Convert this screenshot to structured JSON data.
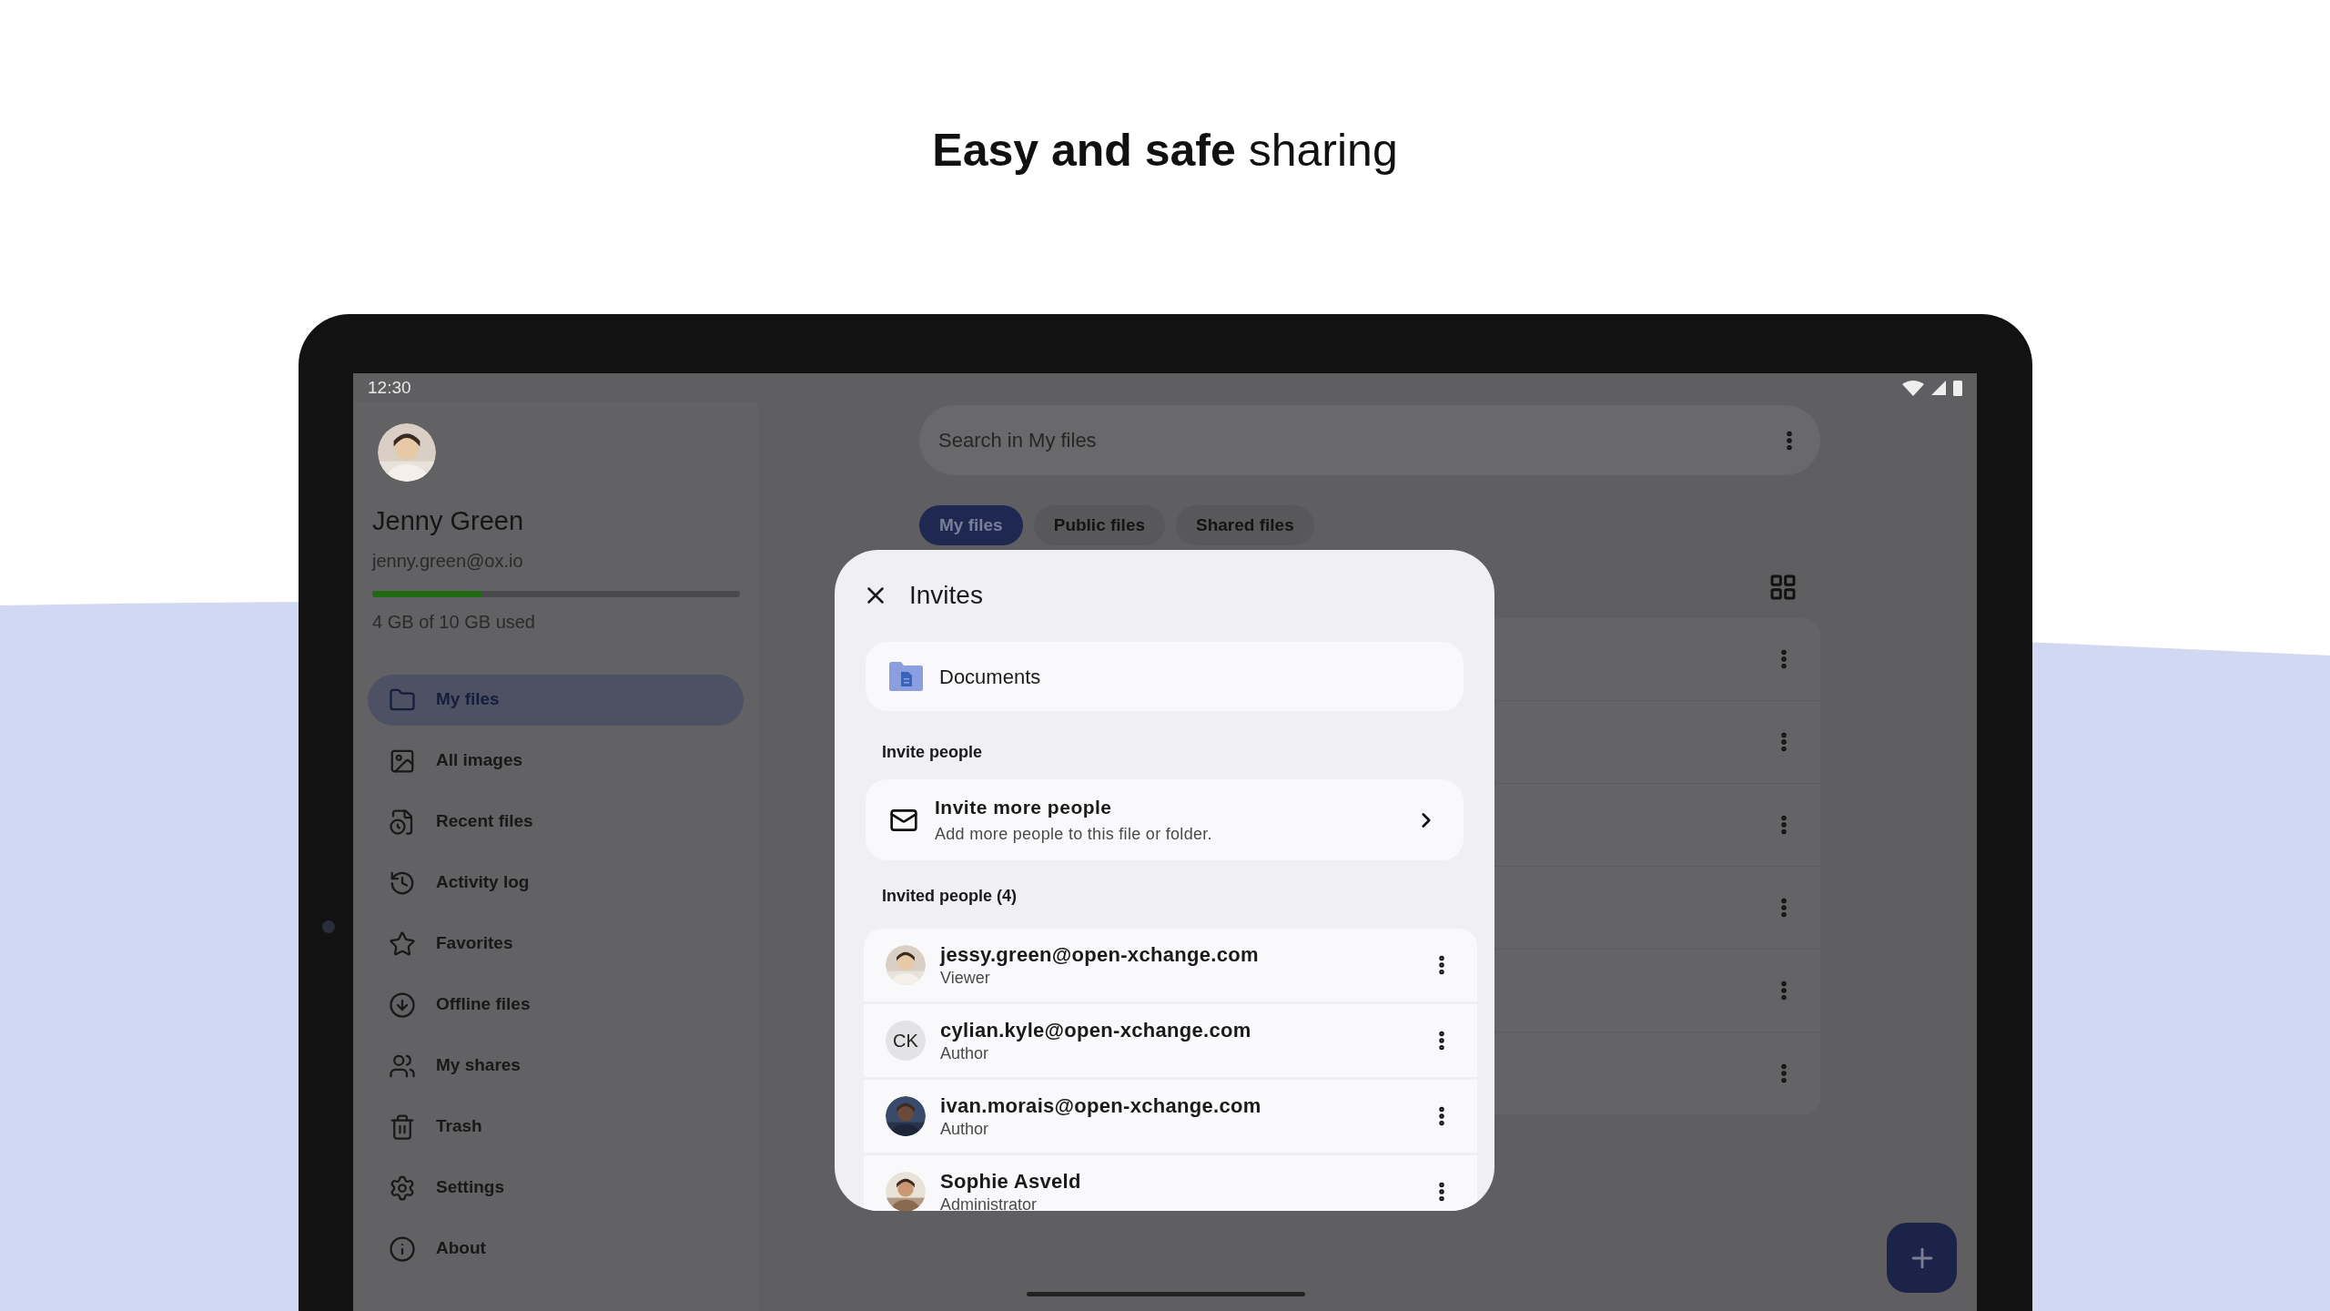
{
  "headline": "**Easy and safe** sharing",
  "status_bar": {
    "time": "12:30"
  },
  "account": {
    "name": "Jenny Green",
    "email": "jenny.green@ox.io",
    "storage": {
      "level": 0.3,
      "label": "4 GB of 10 GB used"
    }
  },
  "nav": [
    {
      "label": "My files",
      "selected": true
    },
    {
      "label": "All images",
      "selected": false
    },
    {
      "label": "Recent files",
      "selected": false
    },
    {
      "label": "Activity log",
      "selected": false
    },
    {
      "label": "Favorites",
      "selected": false
    },
    {
      "label": "Offline files",
      "selected": false
    },
    {
      "label": "My shares",
      "selected": false
    },
    {
      "label": "Trash",
      "selected": false
    },
    {
      "label": "Settings",
      "selected": false
    },
    {
      "label": "About",
      "selected": false
    }
  ],
  "search": {
    "placeholder": "Search in My files"
  },
  "chips": [
    {
      "label": "My files",
      "selected": true
    },
    {
      "label": "Public files",
      "selected": false
    },
    {
      "label": "Shared files",
      "selected": false
    }
  ],
  "dialog": {
    "title": "Invites",
    "folder": "Documents",
    "invite_section": "Invite people",
    "invite_action": {
      "title": "Invite more people",
      "subtitle": "Add more people to this file or folder."
    },
    "invited_section": "Invited people (4)",
    "people": [
      {
        "name": "jessy.green@open-xchange.com",
        "role": "Viewer"
      },
      {
        "name": "cylian.kyle@open-xchange.com",
        "role": "Author",
        "kind": "initials",
        "initials": "CK"
      },
      {
        "name": "ivan.morais@open-xchange.com",
        "role": "Author"
      },
      {
        "name": "Sophie Asveld",
        "role": "Administrator"
      }
    ]
  }
}
